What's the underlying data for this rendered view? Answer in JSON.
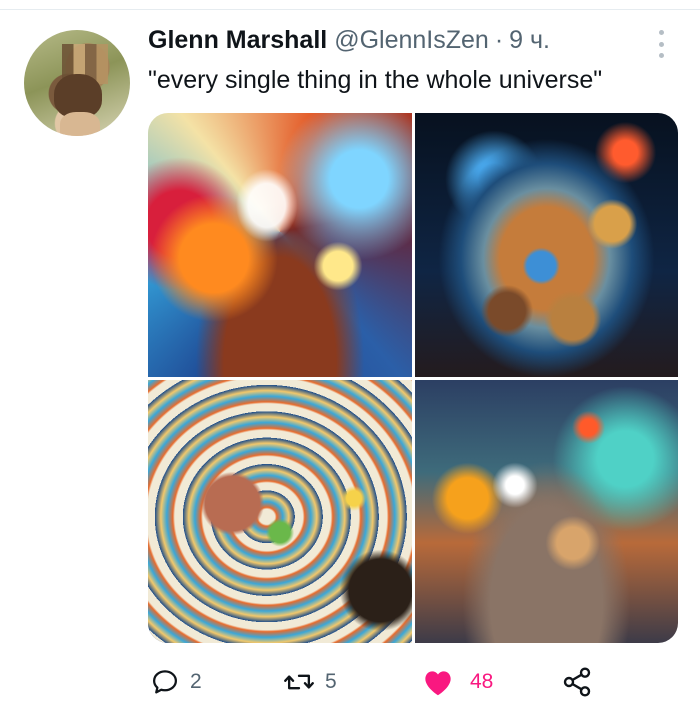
{
  "tweet": {
    "author_name": "Glenn Marshall",
    "author_handle": "@GlennIsZen",
    "separator": "·",
    "timestamp": "9 ч.",
    "text": "\"every single thing in the whole universe\"",
    "media": [
      {
        "name": "universe-image-1"
      },
      {
        "name": "universe-image-2"
      },
      {
        "name": "universe-image-3"
      },
      {
        "name": "universe-image-4"
      }
    ]
  },
  "actions": {
    "reply_count": "2",
    "retweet_count": "5",
    "like_count": "48",
    "liked": true
  },
  "colors": {
    "like_accent": "#f91880",
    "muted_text": "#536471",
    "primary_text": "#0f1419"
  },
  "icons": [
    "more-icon",
    "reply-icon",
    "retweet-icon",
    "heart-icon",
    "share-icon"
  ]
}
